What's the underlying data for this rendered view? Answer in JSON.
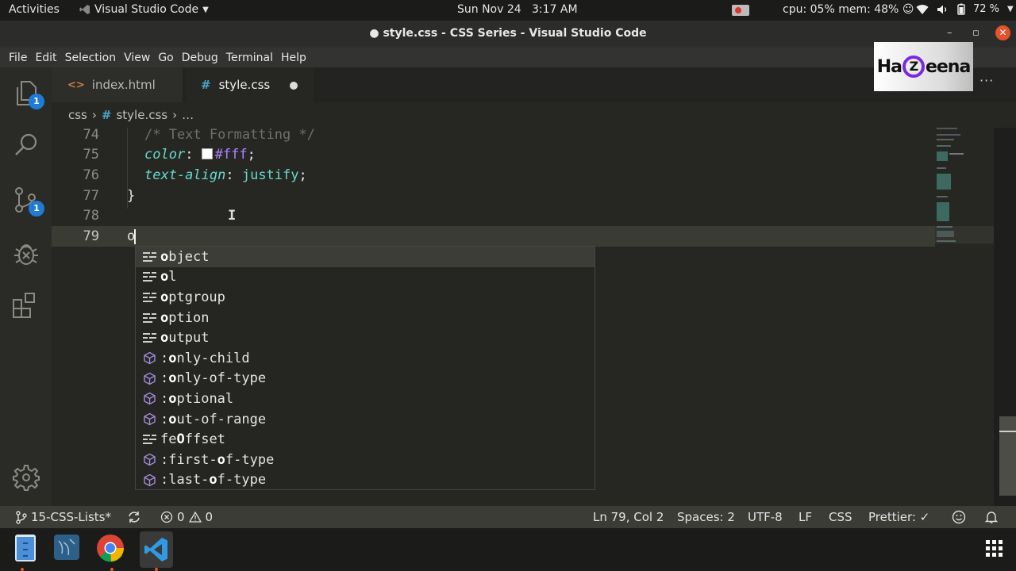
{
  "topbar": {
    "activities": "Activities",
    "app_name": "Visual Studio Code",
    "clock": "Sun Nov 24   3:17 AM",
    "sysmon": "cpu: 05% mem: 48% ☺",
    "battery": "72 %"
  },
  "window": {
    "title": "● style.css - CSS Series - Visual Studio Code",
    "minimize": "–",
    "maximize": "▫",
    "close": "✕"
  },
  "menu": [
    "File",
    "Edit",
    "Selection",
    "View",
    "Go",
    "Debug",
    "Terminal",
    "Help"
  ],
  "activity_bar": {
    "explorer_badge": "1",
    "scm_badge": "1"
  },
  "tabs": [
    {
      "label": "index.html",
      "icon": "<>",
      "active": false
    },
    {
      "label": "style.css",
      "icon": "#",
      "active": true,
      "dirty": true
    }
  ],
  "more_actions": "···",
  "watermark": {
    "pre": "Ha",
    "z": "Z",
    "post": "eena"
  },
  "breadcrumb": {
    "folder": "css",
    "sep": "›",
    "icon": "#",
    "file": "style.css",
    "tail": "…"
  },
  "editor": {
    "lines": [
      {
        "num": "74",
        "comment": "/* Text Formatting */"
      },
      {
        "num": "75",
        "prop": "color",
        "value": "#fff",
        "swatch": "#ffffff"
      },
      {
        "num": "76",
        "prop": "text-align",
        "value": "justify"
      },
      {
        "num": "77",
        "brace": "}"
      },
      {
        "num": "78"
      },
      {
        "num": "79",
        "typed": "o"
      }
    ]
  },
  "suggestions": [
    {
      "kind": "keyword",
      "prefix": "",
      "match": "o",
      "rest": "bject"
    },
    {
      "kind": "keyword",
      "prefix": "",
      "match": "o",
      "rest": "l"
    },
    {
      "kind": "keyword",
      "prefix": "",
      "match": "o",
      "rest": "ptgroup"
    },
    {
      "kind": "keyword",
      "prefix": "",
      "match": "o",
      "rest": "ption"
    },
    {
      "kind": "keyword",
      "prefix": "",
      "match": "o",
      "rest": "utput"
    },
    {
      "kind": "property",
      "prefix": ":",
      "match": "o",
      "rest": "nly-child"
    },
    {
      "kind": "property",
      "prefix": ":",
      "match": "o",
      "rest": "nly-of-type"
    },
    {
      "kind": "property",
      "prefix": ":",
      "match": "o",
      "rest": "ptional"
    },
    {
      "kind": "property",
      "prefix": ":",
      "match": "o",
      "rest": "ut-of-range"
    },
    {
      "kind": "keyword",
      "prefix": "fe",
      "match": "O",
      "rest": "ffset"
    },
    {
      "kind": "property",
      "prefix": ":first-",
      "match": "o",
      "rest": "f-type"
    },
    {
      "kind": "property",
      "prefix": ":last-",
      "match": "o",
      "rest": "f-type"
    }
  ],
  "statusbar": {
    "branch": "15-CSS-Lists*",
    "errors": "0",
    "warnings": "0",
    "position": "Ln 79, Col 2",
    "spaces": "Spaces: 2",
    "encoding": "UTF-8",
    "eol": "LF",
    "language": "CSS",
    "prettier": "Prettier: ✓"
  },
  "dock": [
    "Files",
    "MySQL Workbench",
    "Google Chrome",
    "Visual Studio Code"
  ]
}
